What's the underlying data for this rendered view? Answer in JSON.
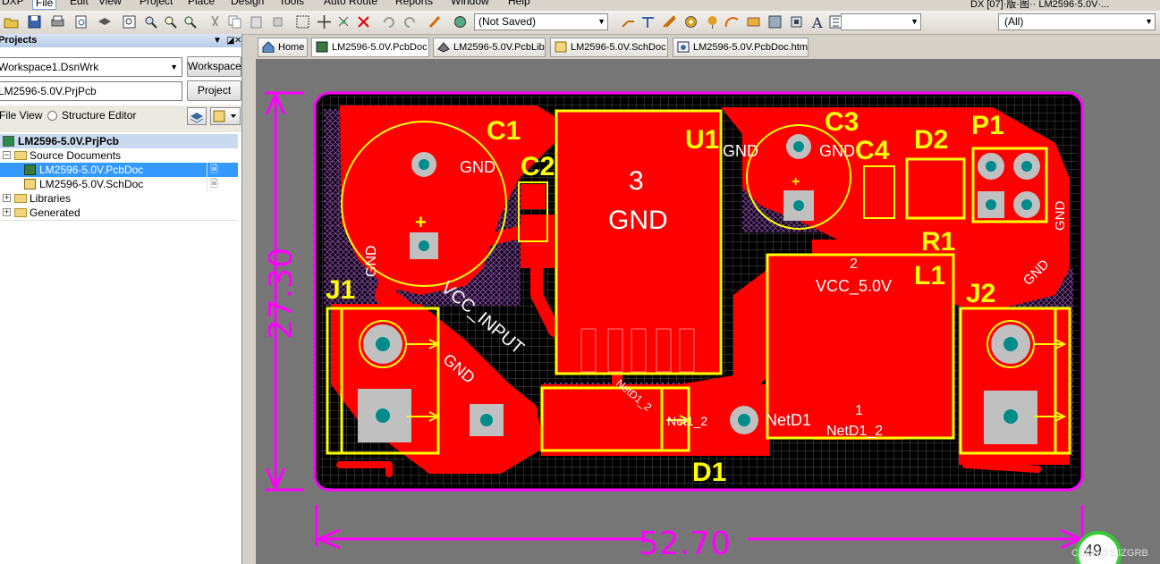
{
  "menu": [
    "DXP",
    "File",
    "Edit",
    "View",
    "Project",
    "Place",
    "Design",
    "Tools",
    "Auto Route",
    "Reports",
    "Window",
    "Help"
  ],
  "toolbar": {
    "save_status": "(Not Saved)",
    "filter_all": "(All)",
    "window_title_partial": "DX [07]·版·图·· LM2596·5.0V·..."
  },
  "panel": {
    "title": "Projects",
    "workspace_value": "Workspace1.DsnWrk",
    "workspace_button": "Workspace",
    "project_value": "LM2596-5.0V.PrjPcb",
    "project_button": "Project",
    "view_file": "File View",
    "view_structure": "Structure Editor",
    "tree": {
      "project": "LM2596-5.0V.PrjPcb",
      "source_folder": "Source Documents",
      "pcb_doc": "LM2596-5.0V.PcbDoc",
      "sch_doc": "LM2596-5.0V.SchDoc",
      "libraries": "Libraries",
      "generated": "Generated"
    }
  },
  "tabs": [
    "Home",
    "LM2596-5.0V.PcbDoc",
    "LM2596-5.0V.PcbLib",
    "LM2596-5.0V.SchDoc",
    "LM2596-5.0V.PcbDoc.htm"
  ],
  "pcb": {
    "designators": {
      "c1": "C1",
      "c2": "C2",
      "u1": "U1",
      "c3": "C3",
      "c4": "C4",
      "d2": "D2",
      "p1": "P1",
      "r1": "R1",
      "l1": "L1",
      "j1": "J1",
      "j2": "J2",
      "d1": "D1"
    },
    "nets": {
      "gnd": "GND",
      "pad3": "3",
      "pad2": "2",
      "pad1": "1",
      "vcc_input": "VCC_INPUT",
      "vcc_5v": "VCC_5.0V",
      "netd1_2": "NetD1_2",
      "netd1": "NetD1",
      "netd1_2_short": "NetD1_2",
      "net_short": "Net1_2"
    },
    "dim_height": "27.30",
    "dim_width": "52.70",
    "plus": "+",
    "watermark": "CSDN@SJZGRB"
  },
  "zoom_badge": "49",
  "colors": {
    "board": "#000000",
    "copper": "#ff0000",
    "silk": "#ffff00",
    "keepout": "#ff00ff",
    "pad": "#c0c0c0",
    "drill": "#008b8b",
    "canvas": "#767676"
  }
}
